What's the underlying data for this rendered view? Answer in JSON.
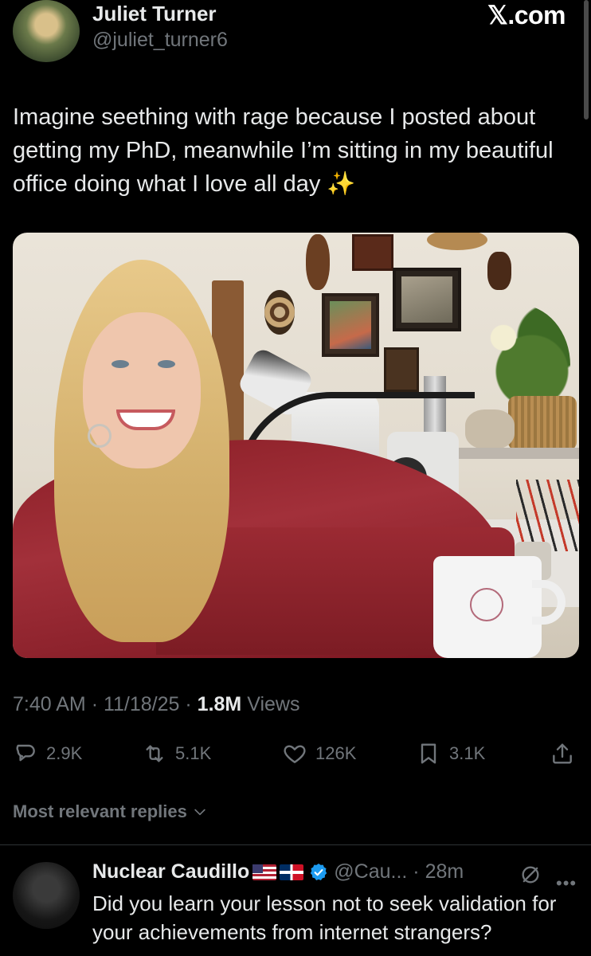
{
  "tweet": {
    "author_name": "Juliet Turner",
    "author_handle": "@juliet_turner6",
    "text": "Imagine seething with rage because I posted about getting my PhD, meanwhile I’m sitting in my beautiful office doing what I love all day ✨",
    "time": "7:40 AM",
    "date": "11/18/25",
    "views_count": "1.8M",
    "views_label": "Views"
  },
  "site_label": "𝕏.com",
  "actions": {
    "replies": "2.9K",
    "reposts": "5.1K",
    "likes": "126K",
    "bookmarks": "3.1K"
  },
  "replies_filter": "Most relevant replies",
  "reply": {
    "name": "Nuclear Caudillo",
    "handle": "@Cau...",
    "time": "28m",
    "text": "Did you learn your lesson not to seek validation for your achievements from internet strangers?"
  },
  "colors": {
    "background": "#000000",
    "text_primary": "#e7e9ea",
    "text_secondary": "#71767b",
    "verified_blue": "#1d9bf0",
    "divider": "#2f3336"
  },
  "icons": [
    "reply-icon",
    "repost-icon",
    "like-icon",
    "bookmark-icon",
    "share-icon",
    "chevron-down-icon",
    "verified-badge-icon",
    "grok-icon",
    "more-icon"
  ]
}
